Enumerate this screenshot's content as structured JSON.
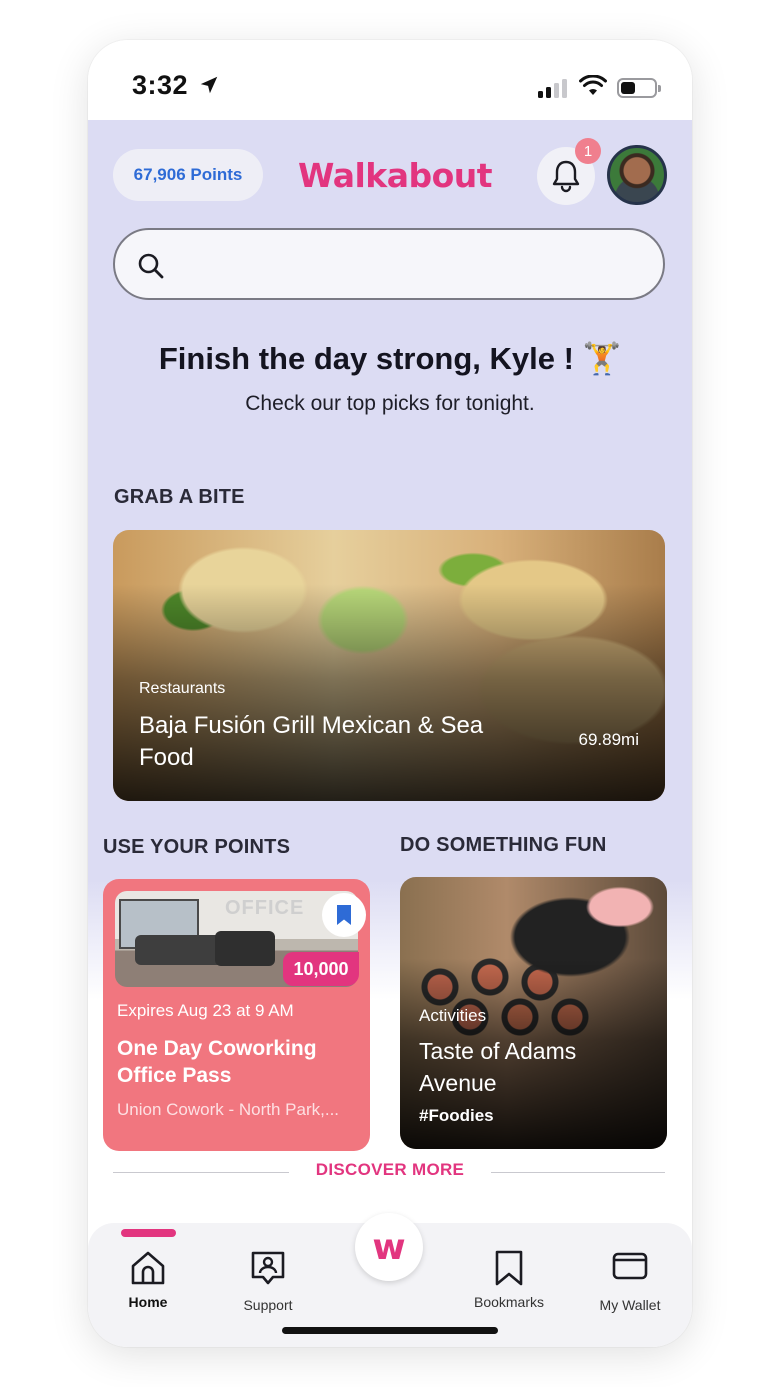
{
  "status_bar": {
    "time": "3:32",
    "icons": [
      "location-arrow-icon",
      "cellular-signal-icon",
      "wifi-icon",
      "battery-icon"
    ]
  },
  "header": {
    "points_label": "67,906 Points",
    "brand": "Walkabout",
    "notification_count": "1",
    "icons": [
      "bell-icon",
      "avatar"
    ]
  },
  "search": {
    "placeholder": "",
    "icon": "search-icon"
  },
  "greeting": {
    "title": "Finish the day strong, Kyle ! 🏋",
    "subtitle": "Check our top picks for tonight."
  },
  "grab_a_bite": {
    "section_title": "GRAB A BITE",
    "card": {
      "category": "Restaurants",
      "title": "Baja Fusión Grill Mexican & Sea Food",
      "distance": "69.89mi"
    }
  },
  "use_your_points": {
    "section_title": "USE YOUR POINTS",
    "card": {
      "image_text": "OFFICE",
      "points": "10,000",
      "expires": "Expires Aug 23 at 9 AM",
      "title": "One Day Coworking Office Pass",
      "location": "Union Cowork - North Park,..."
    }
  },
  "do_something_fun": {
    "section_title": "DO SOMETHING FUN",
    "card": {
      "category": "Activities",
      "title": "Taste of Adams Avenue",
      "tag": "#Foodies"
    }
  },
  "discover_more": "DISCOVER MORE",
  "nav": {
    "items": [
      {
        "label": "Home",
        "icon": "home-icon",
        "active": true
      },
      {
        "label": "Support",
        "icon": "support-icon",
        "active": false
      },
      {
        "label": "",
        "icon": "walkabout-logo-icon",
        "active": false
      },
      {
        "label": "Bookmarks",
        "icon": "bookmark-icon",
        "active": false
      },
      {
        "label": "My Wallet",
        "icon": "wallet-icon",
        "active": false
      }
    ],
    "center_glyph": "w"
  },
  "colors": {
    "brand_pink": "#e2357f",
    "points_blue": "#2e6bd6",
    "background_lavender": "#dcdcf3",
    "coupon_coral": "#f1767f"
  }
}
